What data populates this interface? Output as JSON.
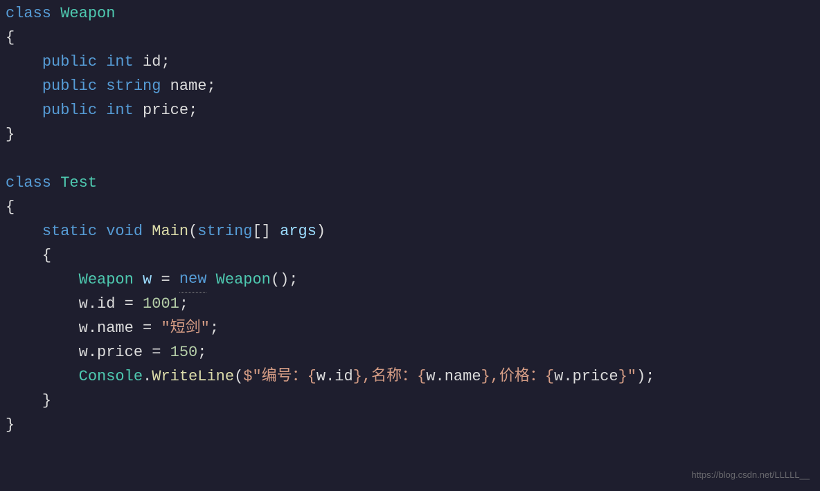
{
  "code": {
    "line1_class": "class",
    "line1_type": "Weapon",
    "line2_brace": "{",
    "line3_public": "public",
    "line3_int": "int",
    "line3_id": "id",
    "line3_semi": ";",
    "line4_public": "public",
    "line4_string": "string",
    "line4_name": "name",
    "line4_semi": ";",
    "line5_public": "public",
    "line5_int": "int",
    "line5_price": "price",
    "line5_semi": ";",
    "line6_brace": "}",
    "line8_class": "class",
    "line8_type": "Test",
    "line9_brace": "{",
    "line10_static": "static",
    "line10_void": "void",
    "line10_main": "Main",
    "line10_lparen": "(",
    "line10_string": "string",
    "line10_brackets": "[]",
    "line10_args": "args",
    "line10_rparen": ")",
    "line11_brace": "{",
    "line12_weapon": "Weapon",
    "line12_w": "w",
    "line12_eq": "=",
    "line12_new": "new",
    "line12_weapon2": "Weapon",
    "line12_parens": "()",
    "line12_semi": ";",
    "line13_w": "w",
    "line13_dot": ".",
    "line13_id": "id",
    "line13_eq": "=",
    "line13_val": "1001",
    "line13_semi": ";",
    "line14_w": "w",
    "line14_dot": ".",
    "line14_name": "name",
    "line14_eq": "=",
    "line14_val": "\"短剑\"",
    "line14_semi": ";",
    "line15_w": "w",
    "line15_dot": ".",
    "line15_price": "price",
    "line15_eq": "=",
    "line15_val": "150",
    "line15_semi": ";",
    "line16_console": "Console",
    "line16_dot": ".",
    "line16_writeline": "WriteLine",
    "line16_lparen": "(",
    "line16_str1": "$\"编号：{",
    "line16_wid": "w.id",
    "line16_str2": "},名称：{",
    "line16_wname": "w.name",
    "line16_str3": "},价格：{",
    "line16_wprice": "w.price",
    "line16_str4": "}\"",
    "line16_rparen": ")",
    "line16_semi": ";",
    "line17_brace": "}",
    "line18_brace": "}"
  },
  "watermark": "https://blog.csdn.net/LLLLL__"
}
